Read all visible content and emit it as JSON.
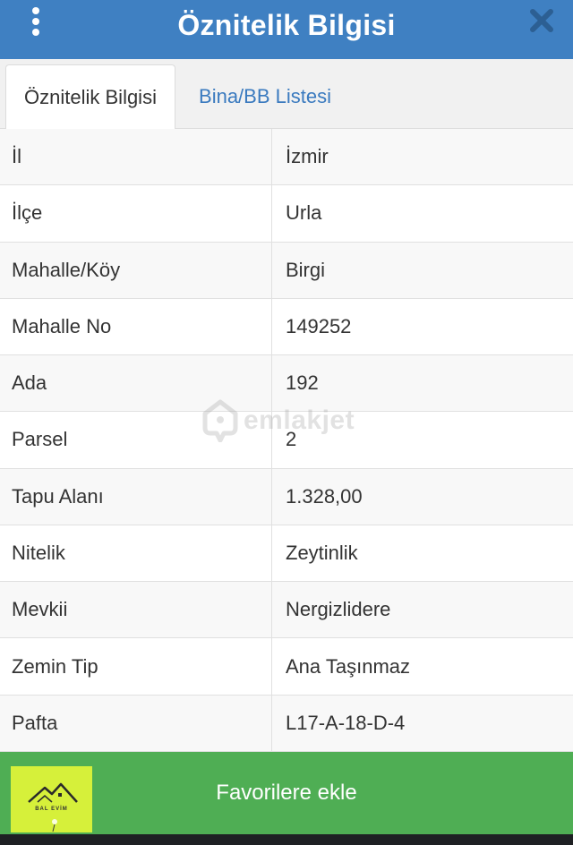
{
  "header": {
    "title": "Öznitelik Bilgisi",
    "menu_icon": "kebab-menu-icon",
    "close_icon": "close-icon"
  },
  "tabs": [
    {
      "label": "Öznitelik Bilgisi",
      "active": true
    },
    {
      "label": "Bina/BB Listesi",
      "active": false
    }
  ],
  "attributes": [
    {
      "key": "İl",
      "value": "İzmir"
    },
    {
      "key": "İlçe",
      "value": "Urla"
    },
    {
      "key": "Mahalle/Köy",
      "value": "Birgi"
    },
    {
      "key": "Mahalle No",
      "value": "149252"
    },
    {
      "key": "Ada",
      "value": "192"
    },
    {
      "key": "Parsel",
      "value": "2"
    },
    {
      "key": "Tapu Alanı",
      "value": "1.328,00"
    },
    {
      "key": "Nitelik",
      "value": "Zeytinlik"
    },
    {
      "key": "Mevkii",
      "value": "Nergizlidere"
    },
    {
      "key": "Zemin Tip",
      "value": "Ana Taşınmaz"
    },
    {
      "key": "Pafta",
      "value": "L17-A-18-D-4"
    }
  ],
  "watermark": {
    "text": "emlakjet"
  },
  "footer": {
    "button_label": "Favorilere ekle",
    "logo_text": "BAL EVİM"
  },
  "colors": {
    "header_bg": "#3f80c2",
    "tab_link": "#3a7abf",
    "footer_bg": "#4fae54",
    "logo_bg": "#d6f03a"
  }
}
